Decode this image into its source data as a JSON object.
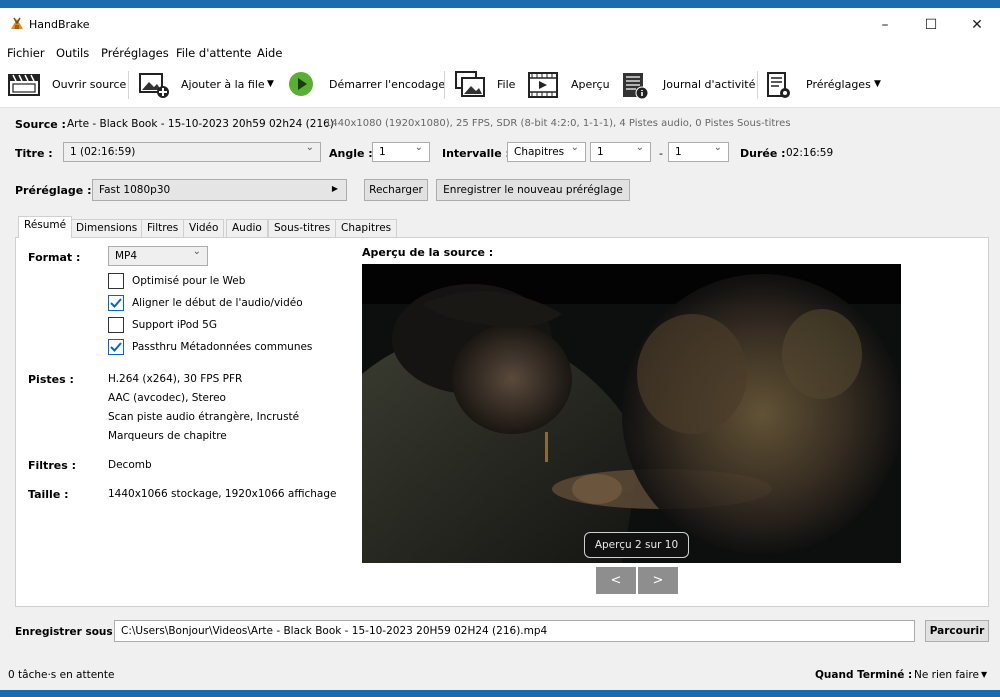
{
  "window": {
    "title": "HandBrake",
    "minimize": "–",
    "maximize": "☐",
    "close": "✕"
  },
  "menu": [
    "Fichier",
    "Outils",
    "Préréglages",
    "File d'attente",
    "Aide"
  ],
  "toolbar": {
    "open_source": "Ouvrir source",
    "add_queue": "Ajouter à la file",
    "start_encode": "Démarrer l'encodage",
    "queue": "File",
    "preview": "Aperçu",
    "activity_log": "Journal d'activité",
    "presets": "Préréglages",
    "accent_start": "#4caf2e"
  },
  "source": {
    "label": "Source :",
    "name": "Arte - Black Book - 15-10-2023 20h59 02h24 (216)",
    "info": "1440x1080 (1920x1080), 25 FPS, SDR (8-bit 4:2:0, 1-1-1), 4 Pistes audio, 0 Pistes Sous-titres"
  },
  "title_row": {
    "title_label": "Titre :",
    "title_value": "1 (02:16:59)",
    "angle_label": "Angle :",
    "angle_value": "1",
    "range_label": "Intervalle :",
    "range_mode": "Chapitres",
    "range_start": "1",
    "range_dash": "-",
    "range_end": "1",
    "duration_label": "Durée :",
    "duration_value": "02:16:59"
  },
  "preset": {
    "label": "Préréglage :",
    "value": "Fast 1080p30",
    "reload": "Recharger",
    "save_new": "Enregistrer le nouveau préréglage"
  },
  "tabs": [
    "Résumé",
    "Dimensions",
    "Filtres",
    "Vidéo",
    "Audio",
    "Sous-titres",
    "Chapitres"
  ],
  "summary": {
    "format_label": "Format :",
    "format_value": "MP4",
    "options": [
      {
        "label": "Optimisé pour le Web",
        "checked": false
      },
      {
        "label": "Aligner le début de l'audio/vidéo",
        "checked": true
      },
      {
        "label": "Support iPod 5G",
        "checked": false
      },
      {
        "label": "Passthru Métadonnées communes",
        "checked": true
      }
    ],
    "tracks_label": "Pistes :",
    "tracks": [
      "H.264 (x264), 30 FPS PFR",
      "AAC (avcodec), Stereo",
      "Scan piste audio étrangère, Incrusté",
      "Marqueurs de chapitre"
    ],
    "filters_label": "Filtres :",
    "filters_value": "Decomb",
    "size_label": "Taille :",
    "size_value": "1440x1066 stockage, 1920x1066 affichage",
    "preview_label": "Aperçu de la source :",
    "preview_counter": "Aperçu 2 sur 10",
    "prev": "<",
    "next": ">"
  },
  "save": {
    "label": "Enregistrer sous :",
    "path": "C:\\Users\\Bonjour\\Videos\\Arte - Black Book - 15-10-2023 20H59 02H24 (216).mp4",
    "browse": "Parcourir"
  },
  "status": {
    "queue_text": "0 tâche·s en attente",
    "when_done_label": "Quand Terminé :",
    "when_done_value": "Ne rien faire"
  }
}
